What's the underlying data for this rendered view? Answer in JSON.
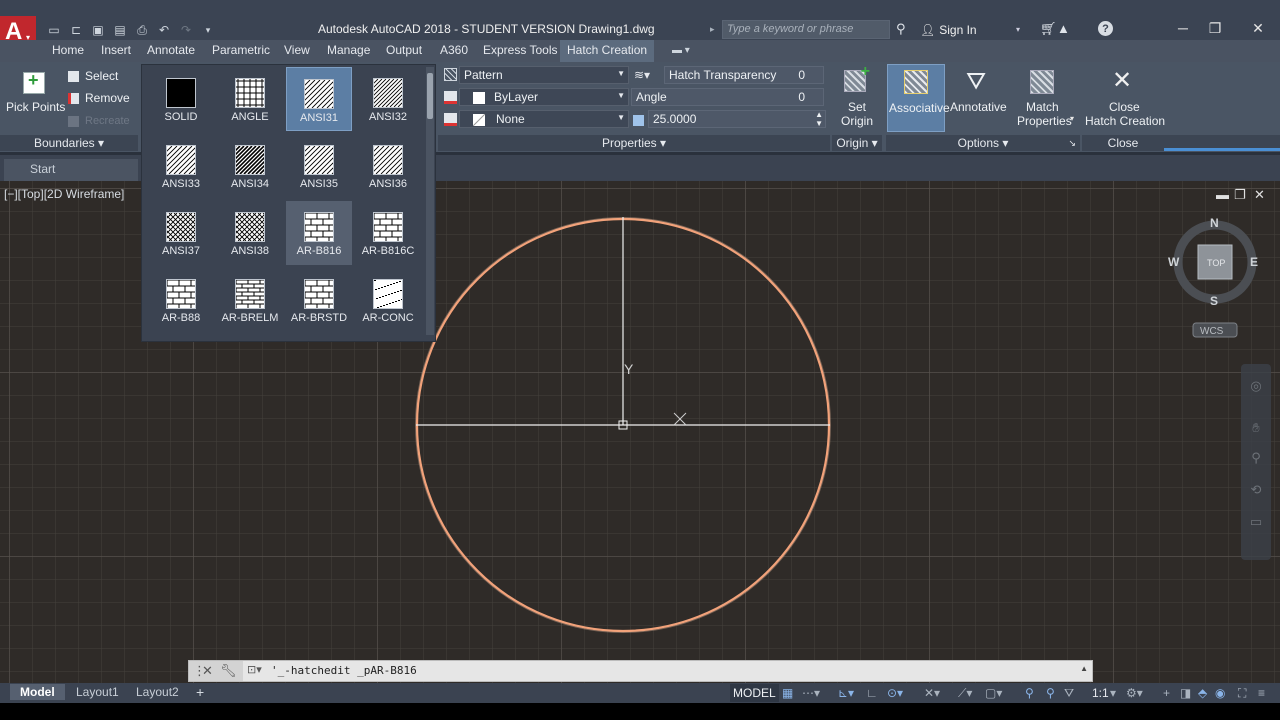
{
  "titlebar": {
    "title": "Autodesk AutoCAD 2018 - STUDENT VERSION    Drawing1.dwg",
    "search_placeholder": "Type a keyword or phrase",
    "sign_in": "Sign In"
  },
  "ribbon_tabs": [
    "Home",
    "Insert",
    "Annotate",
    "Parametric",
    "View",
    "Manage",
    "Output",
    "A360",
    "Express Tools",
    "Hatch Creation"
  ],
  "boundaries": {
    "pick_points": "Pick Points",
    "select": "Select",
    "remove": "Remove",
    "recreate": "Recreate",
    "title": "Boundaries"
  },
  "gallery": {
    "patterns": [
      "SOLID",
      "ANGLE",
      "ANSI31",
      "ANSI32",
      "ANSI33",
      "ANSI34",
      "ANSI35",
      "ANSI36",
      "ANSI37",
      "ANSI38",
      "AR-B816",
      "AR-B816C",
      "AR-B88",
      "AR-BRELM",
      "AR-BRSTD",
      "AR-CONC"
    ],
    "selected": "ANSI31",
    "hovered": "AR-B816"
  },
  "properties": {
    "pattern_type": "Pattern",
    "hatch_transparency_label": "Hatch Transparency",
    "hatch_transparency_value": "0",
    "color": "ByLayer",
    "angle_label": "Angle",
    "angle_value": "0",
    "background": "None",
    "scale": "25.0000",
    "title": "Properties"
  },
  "origin": {
    "set_origin_1": "Set",
    "set_origin_2": "Origin",
    "title": "Origin"
  },
  "options": {
    "associative": "Associative",
    "annotative": "Annotative",
    "match_1": "Match",
    "match_2": "Properties",
    "title": "Options"
  },
  "close": {
    "close_1": "Close",
    "close_2": "Hatch Creation",
    "title": "Close"
  },
  "file_tabs": {
    "start": "Start"
  },
  "viewport": {
    "label": "[−][Top][2D Wireframe]",
    "ucs_y": "Y",
    "viewcube": {
      "n": "N",
      "s": "S",
      "e": "E",
      "w": "W",
      "top": "TOP",
      "wcs": "WCS"
    }
  },
  "command_line": {
    "text": "'_-hatchedit _pAR-B816"
  },
  "statusbar": {
    "tabs": [
      "Model",
      "Layout1",
      "Layout2"
    ],
    "model_space": "MODEL",
    "scale": "1:1"
  },
  "colors": {
    "circle": "#f2a27a",
    "accent": "#5c7ea4",
    "logo": "#c1272d"
  }
}
